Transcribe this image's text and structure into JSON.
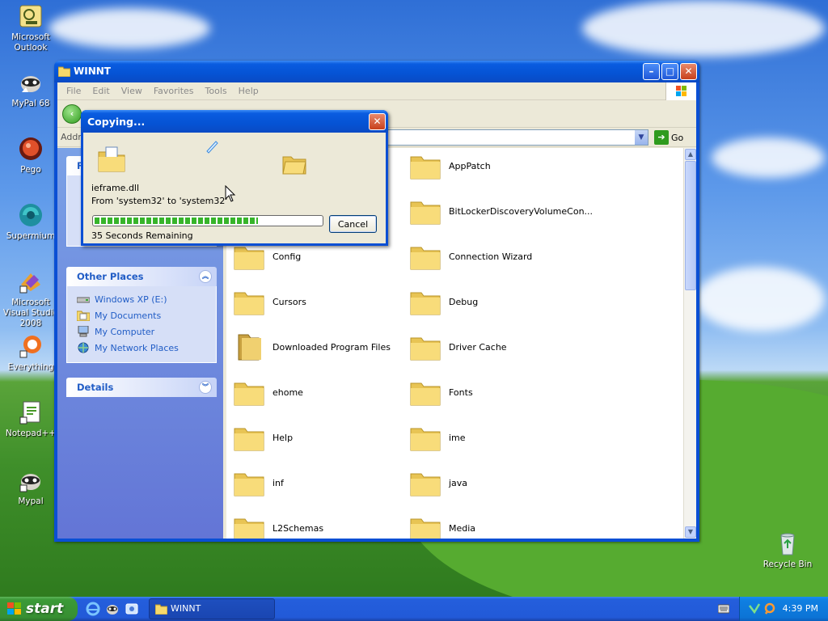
{
  "desktop": {
    "icons": [
      {
        "id": "outlook",
        "label": "Microsoft Outlook"
      },
      {
        "id": "mypal68",
        "label": "MyPal 68"
      },
      {
        "id": "pego",
        "label": "Pego"
      },
      {
        "id": "supermium",
        "label": "Supermium"
      },
      {
        "id": "msvs",
        "label": "Microsoft Visual Studio 2008"
      },
      {
        "id": "everything",
        "label": "Everything"
      },
      {
        "id": "notepadpp",
        "label": "Notepad++"
      },
      {
        "id": "mypal",
        "label": "Mypal"
      },
      {
        "id": "recycle",
        "label": "Recycle Bin"
      }
    ]
  },
  "explorer": {
    "title": "WINNT",
    "menu": [
      "File",
      "Edit",
      "View",
      "Favorites",
      "Tools",
      "Help"
    ],
    "address_label": "Addr",
    "go_label": "Go",
    "taskpane": {
      "other_places": {
        "heading": "Other Places",
        "links": [
          "Windows XP (E:)",
          "My Documents",
          "My Computer",
          "My Network Places"
        ]
      },
      "details": {
        "heading": "Details"
      },
      "first_box_letter": "F"
    },
    "files": [
      "AppPatch",
      "BitLockerDiscoveryVolumeCon...",
      "Config",
      "Connection Wizard",
      "Cursors",
      "Debug",
      "Downloaded Program Files",
      "Driver Cache",
      "ehome",
      "Fonts",
      "Help",
      "ime",
      "inf",
      "java",
      "L2Schemas",
      "Media"
    ]
  },
  "copy_dialog": {
    "title": "Copying...",
    "filename": "ieframe.dll",
    "from_to": "From 'system32' to 'system32'",
    "progress": 0.72,
    "remaining": "35 Seconds Remaining",
    "cancel_label": "Cancel"
  },
  "taskbar": {
    "start_label": "start",
    "task_label": "WINNT",
    "clock": "4:39 PM"
  },
  "colors": {
    "xp_blue": "#0a4fd4",
    "link_blue": "#215dc6",
    "progress_green": "#37b42a",
    "folder_yellow": "#f6d96b"
  }
}
